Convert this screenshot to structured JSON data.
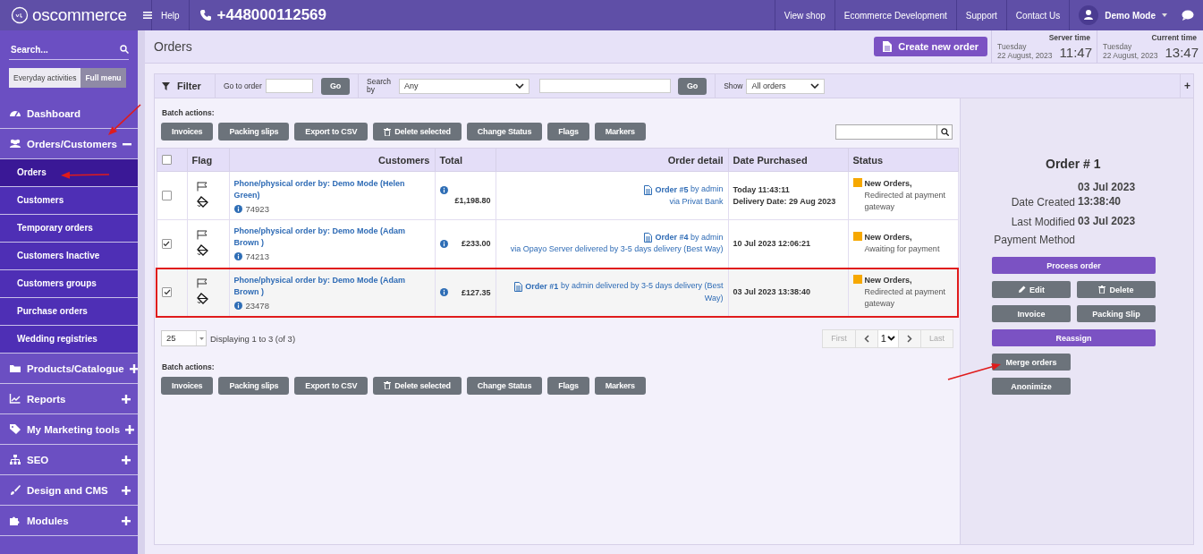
{
  "topbar": {
    "logo": "oscommerce",
    "help": "Help",
    "phone": "+448000112569",
    "links": [
      "View shop",
      "Ecommerce Development",
      "Support",
      "Contact Us"
    ],
    "user": "Demo Mode"
  },
  "sidebar": {
    "search": {
      "placeholder": "Search..."
    },
    "modes": [
      {
        "label": "Everyday activities",
        "selected": false
      },
      {
        "label": "Full menu",
        "selected": true
      }
    ],
    "items": [
      {
        "label": "Dashboard"
      },
      {
        "label": "Orders/Customers",
        "expanded": true,
        "children": [
          {
            "label": "Orders",
            "selected": true
          },
          {
            "label": "Customers",
            "selected": false
          },
          {
            "label": "Temporary orders",
            "selected": false
          },
          {
            "label": "Customers Inactive",
            "selected": false
          },
          {
            "label": "Customers groups",
            "selected": false
          },
          {
            "label": "Purchase orders",
            "selected": false
          },
          {
            "label": "Wedding registries",
            "selected": false
          }
        ]
      },
      {
        "label": "Products/Catalogue",
        "expanded": false
      },
      {
        "label": "Reports",
        "expanded": false
      },
      {
        "label": "My Marketing tools",
        "expanded": false
      },
      {
        "label": "SEO",
        "expanded": false
      },
      {
        "label": "Design and CMS",
        "expanded": false
      },
      {
        "label": "Modules",
        "expanded": false
      }
    ]
  },
  "header": {
    "title": "Orders",
    "create_button": "Create new order",
    "clocks": [
      {
        "label": "Server time",
        "day": "Tuesday",
        "date": "22 August, 2023",
        "time": "11:47"
      },
      {
        "label": "Current time",
        "day": "Tuesday",
        "date": "22 August, 2023",
        "time": "13:47"
      }
    ]
  },
  "filter": {
    "title": "Filter",
    "goto_label": "Go to order",
    "goto_button": "Go",
    "search_by_label": "Search by",
    "search_by_value": "Any",
    "search_button": "Go",
    "show_label": "Show",
    "show_value": "All orders",
    "expand": "+"
  },
  "batch_top": {
    "label": "Batch actions:",
    "buttons": [
      {
        "label": "Invoices",
        "kind": "plain"
      },
      {
        "label": "Packing slips",
        "kind": "plain"
      },
      {
        "label": "Export to CSV",
        "kind": "plain"
      },
      {
        "label": "Delete selected",
        "kind": "delete"
      },
      {
        "label": "Change Status",
        "kind": "plain"
      },
      {
        "label": "Flags",
        "kind": "plain"
      },
      {
        "label": "Markers",
        "kind": "plain"
      }
    ]
  },
  "table": {
    "columns": [
      "Flag",
      "Customers",
      "Total",
      "Order detail",
      "Date Purchased",
      "Status"
    ],
    "select_all": false,
    "rows": [
      {
        "checked": false,
        "highlighted": false,
        "customer": "Phone/physical order by: Demo Mode (Helen Green)",
        "customer_id": "74923",
        "total": "£1,198.80",
        "order": "Order #5",
        "order_note": "by admin",
        "payment": "via Privat Bank",
        "date": [
          "Today 11:43:11",
          "Delivery Date: 29 Aug 2023"
        ],
        "status": "New Orders,",
        "status_note": "Redirected at payment gateway"
      },
      {
        "checked": true,
        "highlighted": false,
        "customer": "Phone/physical order by: Demo Mode (Adam Brown )",
        "customer_id": "74213",
        "total": "£233.00",
        "order": "Order #4",
        "order_note": "by admin",
        "payment": "via Opayo Server delivered by 3-5 days delivery (Best Way)",
        "date": [
          "10 Jul 2023 12:06:21"
        ],
        "status": "New Orders,",
        "status_note": "Awaiting for payment"
      },
      {
        "checked": true,
        "highlighted": true,
        "customer": "Phone/physical order by: Demo Mode (Adam Brown )",
        "customer_id": "23478",
        "total": "£127.35",
        "order": "Order #1",
        "order_note": "by admin delivered by 3-5 days delivery (Best Way)",
        "date": [
          "03 Jul 2023 13:38:40"
        ],
        "status": "New Orders,",
        "status_note": "Redirected at payment gateway"
      }
    ]
  },
  "pagination": {
    "per_page": "25",
    "summary": "Displaying 1 to 3 (of 3)",
    "first": "First",
    "page": "1",
    "last": "Last",
    "first_disabled": true,
    "last_disabled": true
  },
  "batch_bottom": {
    "label": "Batch actions:",
    "buttons": [
      {
        "label": "Invoices",
        "kind": "plain"
      },
      {
        "label": "Packing slips",
        "kind": "plain"
      },
      {
        "label": "Export to CSV",
        "kind": "plain"
      },
      {
        "label": "Delete selected",
        "kind": "delete"
      },
      {
        "label": "Change Status",
        "kind": "plain"
      },
      {
        "label": "Flags",
        "kind": "plain"
      },
      {
        "label": "Markers",
        "kind": "plain"
      }
    ]
  },
  "detail": {
    "title": "Order # 1",
    "fields": [
      {
        "label": "Date Created",
        "value": "03 Jul 2023 13:38:40"
      },
      {
        "label": "Last Modified",
        "value": "03 Jul 2023"
      },
      {
        "label": "Payment Method"
      }
    ],
    "buttons": [
      {
        "label": "Process order",
        "kind": "primary"
      },
      {
        "label": "Edit",
        "kind": "edit"
      },
      {
        "label": "Delete",
        "kind": "delete"
      },
      {
        "label": "Invoice",
        "kind": "half"
      },
      {
        "label": "Packing Slip",
        "kind": "half"
      },
      {
        "label": "Reassign",
        "kind": "primary"
      },
      {
        "label": "Merge orders",
        "kind": "single"
      },
      {
        "label": "Anonimize",
        "kind": "single"
      }
    ]
  }
}
